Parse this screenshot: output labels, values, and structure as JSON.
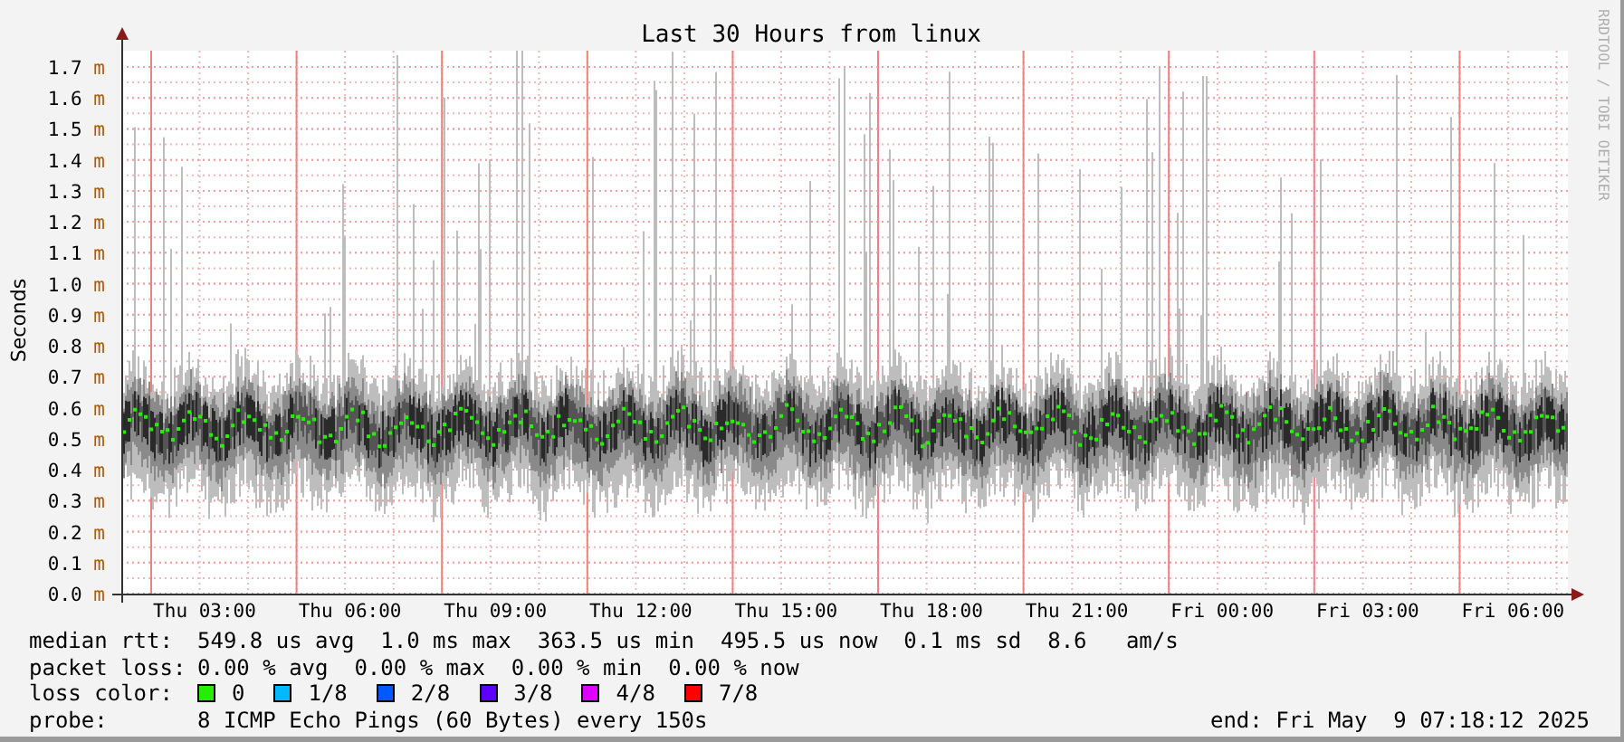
{
  "chart": {
    "title": "Last 30 Hours from linux",
    "credit": "RRDTOOL / TOBI OETIKER",
    "ylabel": "Seconds",
    "yticks": [
      {
        "value": "1.7",
        "unit": "m"
      },
      {
        "value": "1.6",
        "unit": "m"
      },
      {
        "value": "1.5",
        "unit": "m"
      },
      {
        "value": "1.4",
        "unit": "m"
      },
      {
        "value": "1.3",
        "unit": "m"
      },
      {
        "value": "1.2",
        "unit": "m"
      },
      {
        "value": "1.1",
        "unit": "m"
      },
      {
        "value": "1.0",
        "unit": "m"
      },
      {
        "value": "0.9",
        "unit": "m"
      },
      {
        "value": "0.8",
        "unit": "m"
      },
      {
        "value": "0.7",
        "unit": "m"
      },
      {
        "value": "0.6",
        "unit": "m"
      },
      {
        "value": "0.5",
        "unit": "m"
      },
      {
        "value": "0.4",
        "unit": "m"
      },
      {
        "value": "0.3",
        "unit": "m"
      },
      {
        "value": "0.2",
        "unit": "m"
      },
      {
        "value": "0.1",
        "unit": "m"
      },
      {
        "value": "0.0",
        "unit": "m"
      }
    ],
    "xticks": [
      "Thu 03:00",
      "Thu 06:00",
      "Thu 09:00",
      "Thu 12:00",
      "Thu 15:00",
      "Thu 18:00",
      "Thu 21:00",
      "Fri 00:00",
      "Fri 03:00",
      "Fri 06:00"
    ]
  },
  "legend": [
    {
      "label": "median rtt:",
      "text": "549.8 us avg  1.0 ms max  363.5 us min  495.5 us now  0.1 ms sd  8.6   am/s"
    },
    {
      "label": "packet loss:",
      "text": "0.00 % avg  0.00 % max  0.00 % min  0.00 % now"
    }
  ],
  "loss_colors": {
    "label": "loss color:",
    "items": [
      {
        "label": "0",
        "color": "#26ee00"
      },
      {
        "label": "1/8",
        "color": "#00b8ff"
      },
      {
        "label": "2/8",
        "color": "#0059ff"
      },
      {
        "label": "3/8",
        "color": "#5e00ff"
      },
      {
        "label": "4/8",
        "color": "#dd00ff"
      },
      {
        "label": "7/8",
        "color": "#ff0000"
      }
    ]
  },
  "probe": {
    "label": "probe:",
    "text": "8 ICMP Echo Pings (60 Bytes) every 150s"
  },
  "end": "end: Fri May  9 07:18:12 2025"
}
